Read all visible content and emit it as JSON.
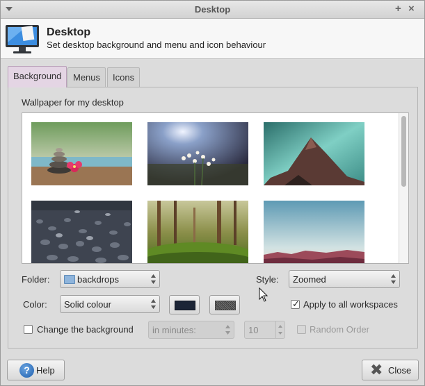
{
  "window": {
    "title": "Desktop"
  },
  "header": {
    "title": "Desktop",
    "subtitle": "Set desktop background and menu and icon behaviour",
    "icon": "monitor-icon"
  },
  "tabs": [
    {
      "label": "Background",
      "active": true
    },
    {
      "label": "Menus",
      "active": false
    },
    {
      "label": "Icons",
      "active": false
    }
  ],
  "background": {
    "wallpaper_label": "Wallpaper for my desktop",
    "folder_label": "Folder:",
    "folder_value": "backdrops",
    "style_label": "Style:",
    "style_value": "Zoomed",
    "color_label": "Color:",
    "color_value": "Solid colour",
    "primary_color": "#1c2536",
    "apply_all_label": "Apply to all workspaces",
    "apply_all_checked": true,
    "change_bg_label": "Change the background",
    "change_bg_checked": false,
    "interval_unit": "in minutes:",
    "interval_value": "10",
    "random_order_label": "Random Order",
    "random_order_checked": false
  },
  "buttons": {
    "help_label": "Help",
    "close_label": "Close"
  },
  "colors": {
    "active_tab": "#e4d5e4",
    "window_bg": "#dcdcdc",
    "help_blue": "#1f5fae"
  }
}
